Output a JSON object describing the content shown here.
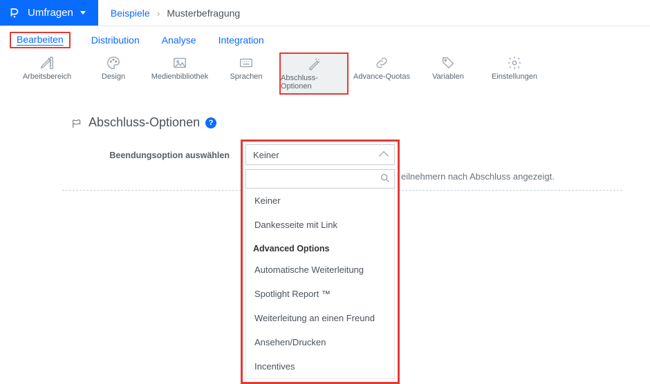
{
  "brand": {
    "label": "Umfragen"
  },
  "breadcrumb": {
    "link": "Beispiele",
    "current": "Musterbefragung"
  },
  "tabs": {
    "edit": "Bearbeiten",
    "distribution": "Distribution",
    "analyse": "Analyse",
    "integration": "Integration"
  },
  "toolbar": {
    "workspace": "Arbeitsbereich",
    "design": "Design",
    "media": "Medienbibliothek",
    "languages": "Sprachen",
    "finish": "Abschluss-Optionen",
    "quotas": "Advance-Quotas",
    "variables": "Variablen",
    "settings": "Einstellungen"
  },
  "panel": {
    "title": "Abschluss-Optionen",
    "help": "?"
  },
  "form": {
    "select_label": "Beendungsoption auswählen",
    "selected": "Keiner",
    "note_suffix": "eilnehmern nach Abschluss angezeigt.",
    "search_placeholder": ""
  },
  "dropdown": {
    "items_a": [
      "Keiner",
      "Dankesseite mit Link"
    ],
    "group": "Advanced Options",
    "items_b": [
      "Automatische Weiterleitung",
      "Spotlight Report ™",
      "Weiterleitung an einen Freund",
      "Ansehen/Drucken",
      "Incentives"
    ]
  }
}
